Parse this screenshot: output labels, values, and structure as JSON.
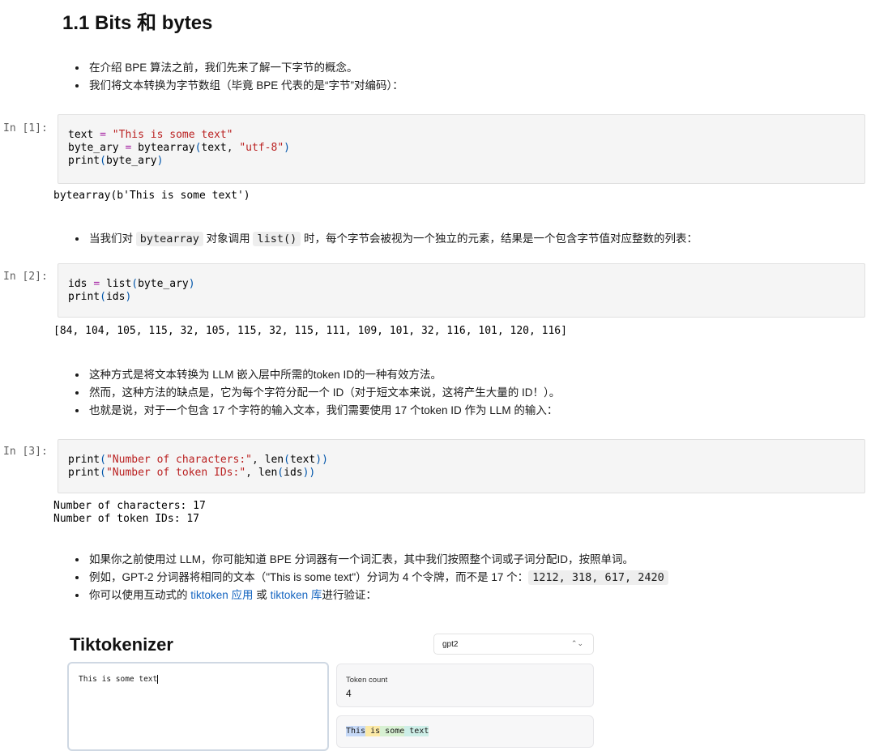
{
  "section": {
    "title": "1.1 Bits 和 bytes"
  },
  "intro_bullets": [
    "在介绍 BPE 算法之前，我们先来了解一下字节的概念。",
    "我们将文本转换为字节数组（毕竟 BPE 代表的是“字节”对编码）："
  ],
  "cell1": {
    "prompt": "In [1]:",
    "line1": {
      "var": "text",
      "op": "=",
      "str": "\"This is some text\""
    },
    "line2": {
      "var": "byte_ary",
      "op": "=",
      "fn": "bytearray",
      "open": "(",
      "arg": "text",
      "comma": ", ",
      "str": "\"utf-8\"",
      "close": ")"
    },
    "line3": {
      "fn": "print",
      "open": "(",
      "arg": "byte_ary",
      "close": ")"
    },
    "output": "bytearray(b'This is some text')"
  },
  "bytearray_bullet": {
    "pre": "当我们对 ",
    "code1": "bytearray",
    "mid": " 对象调用 ",
    "code2": "list()",
    "post": " 时，每个字节会被视为一个独立的元素，结果是一个包含字节值对应整数的列表："
  },
  "cell2": {
    "prompt": "In [2]:",
    "line1": {
      "var": "ids",
      "op": "=",
      "fn": "list",
      "open": "(",
      "arg": "byte_ary",
      "close": ")"
    },
    "line2": {
      "fn": "print",
      "open": "(",
      "arg": "ids",
      "close": ")"
    },
    "output": "[84, 104, 105, 115, 32, 105, 115, 32, 115, 111, 109, 101, 32, 116, 101, 120, 116]"
  },
  "mid_bullets": [
    "这种方式是将文本转换为 LLM 嵌入层中所需的token ID的一种有效方法。",
    "然而，这种方法的缺点是，它为每个字符分配一个 ID（对于短文本来说，这将产生大量的 ID！）。",
    "也就是说，对于一个包含 17 个字符的输入文本，我们需要使用 17 个token ID 作为 LLM 的输入："
  ],
  "cell3": {
    "prompt": "In [3]:",
    "line1": {
      "fn": "print",
      "open": "(",
      "str": "\"Number of characters:\"",
      "comma": ", ",
      "fn2": "len",
      "open2": "(",
      "arg": "text",
      "close": "))"
    },
    "line2": {
      "fn": "print",
      "open": "(",
      "str": "\"Number of token IDs:\"",
      "comma": ", ",
      "fn2": "len",
      "open2": "(",
      "arg": "ids",
      "close": "))"
    },
    "output": "Number of characters: 17\nNumber of token IDs: 17"
  },
  "end_bullets": {
    "b1": "如果你之前使用过 LLM，你可能知道 BPE 分词器有一个词汇表，其中我们按照整个词或子词分配ID，按照单词。",
    "b2_pre": "例如，GPT-2 分词器将相同的文本（\"This is some text\"）分词为 4 个令牌，而不是 17 个：",
    "b2_code": "1212, 318, 617, 2420",
    "b3_pre": "你可以使用互动式的 ",
    "b3_link1": "tiktoken 应用",
    "b3_mid": " 或 ",
    "b3_link2": "tiktoken 库",
    "b3_post": "进行验证："
  },
  "tiktokenizer": {
    "title": "Tiktokenizer",
    "model_selected": "gpt2",
    "input_text": "This is some text",
    "token_count_label": "Token count",
    "token_count_value": "4",
    "tokens": [
      {
        "text": "This",
        "color": "#c6d9f7"
      },
      {
        "text": " is",
        "color": "#fbe9a6"
      },
      {
        "text": " some",
        "color": "#d7f0d2"
      },
      {
        "text": " text",
        "color": "#cdeee7"
      }
    ]
  },
  "colors": {
    "link": "#1565c0",
    "string": "#ba2121",
    "operator": "#a626a4",
    "paren": "#0055aa",
    "cell_bg": "#f5f5f5"
  }
}
